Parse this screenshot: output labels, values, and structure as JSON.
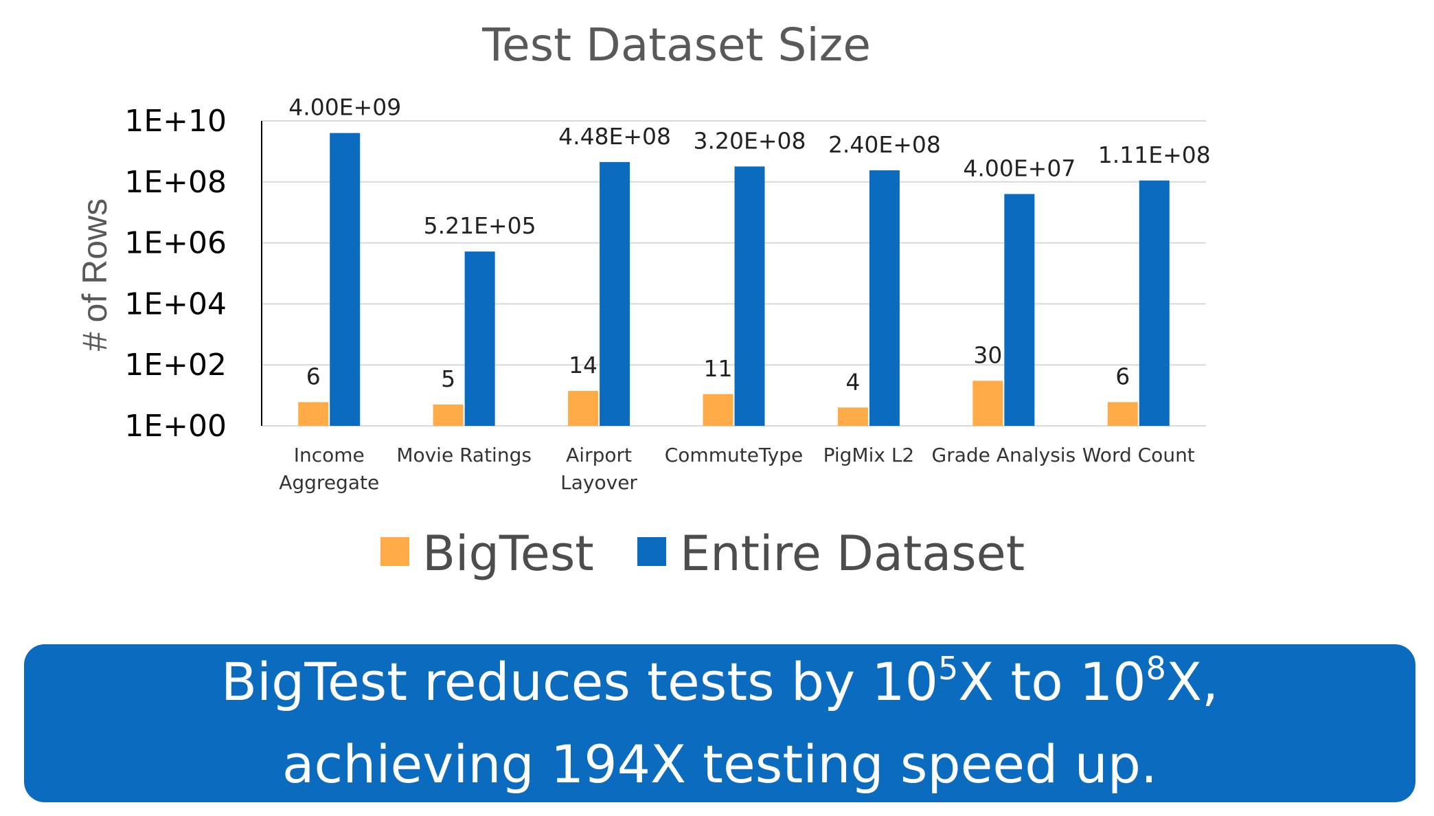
{
  "chart_data": {
    "type": "bar",
    "title": "Test Dataset Size",
    "ylabel": "# of Rows",
    "xlabel": "",
    "yscale": "log",
    "ylim": [
      1,
      10000000000
    ],
    "yticks": [
      1,
      100,
      10000,
      1000000,
      100000000,
      10000000000
    ],
    "ytick_labels": [
      "1E+00",
      "1E+02",
      "1E+04",
      "1E+06",
      "1E+08",
      "1E+10"
    ],
    "grid": true,
    "legend_position": "bottom",
    "categories": [
      [
        "Income",
        "Aggregate"
      ],
      [
        "Movie Ratings"
      ],
      [
        "Airport",
        "Layover"
      ],
      [
        "CommuteType"
      ],
      [
        "PigMix L2"
      ],
      [
        "Grade Analysis"
      ],
      [
        "Word Count"
      ]
    ],
    "series": [
      {
        "name": "BigTest",
        "color": "#ffab47",
        "values": [
          6,
          5,
          14,
          11,
          4,
          30,
          6
        ],
        "labels": [
          "6",
          "5",
          "14",
          "11",
          "4",
          "30",
          "6"
        ]
      },
      {
        "name": "Entire Dataset",
        "color": "#0b6cbf",
        "values": [
          4000000000,
          521000,
          448000000,
          320000000,
          240000000,
          40000000,
          111000000
        ],
        "labels": [
          "4.00E+09",
          "5.21E+05",
          "4.48E+08",
          "3.20E+08",
          "2.40E+08",
          "4.00E+07",
          "1.11E+08"
        ]
      }
    ]
  },
  "banner": {
    "line1_pre": "BigTest reduces tests by 10",
    "line1_sup1": "5",
    "line1_mid": "X to 10",
    "line1_sup2": "8",
    "line1_post": "X,",
    "line2": "achieving 194X testing speed up."
  }
}
